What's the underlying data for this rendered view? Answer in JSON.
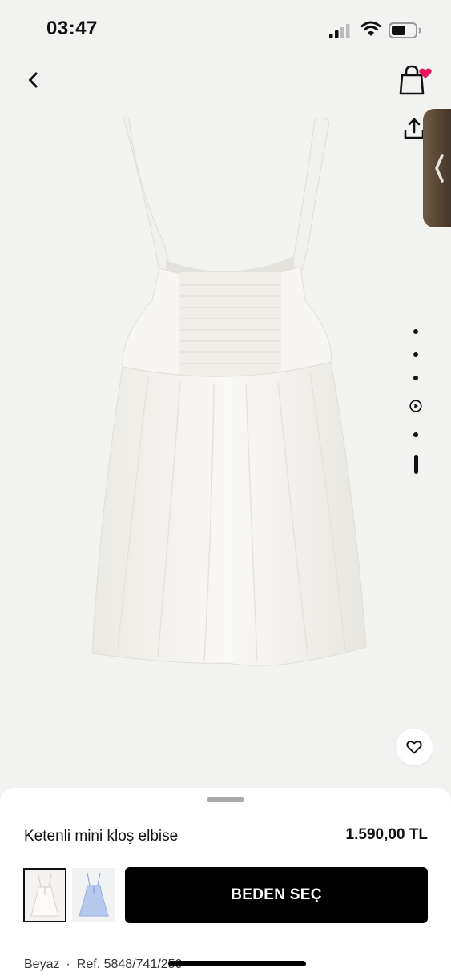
{
  "status_bar": {
    "time": "03:47"
  },
  "header": {
    "back_icon": "chevron-left-icon",
    "bag_icon": "shopping-bag-icon",
    "bag_badge_icon": "heart-icon",
    "bag_badge_color": "#e8175d",
    "share_icon": "share-icon",
    "side_tab_icon": "chevron-left-icon"
  },
  "gallery": {
    "dot_count": 5,
    "video_icon": "play-icon",
    "favorite_icon": "heart-outline-icon"
  },
  "product": {
    "name": "Ketenli mini kloş elbise",
    "price": "1.590,00 TL",
    "color_name": "Beyaz",
    "separator": "·",
    "ref": "Ref. 5848/741/250",
    "variants": [
      "white",
      "light-blue"
    ]
  },
  "actions": {
    "select_size_label": "BEDEN SEÇ"
  },
  "colors": {
    "background": "#f2f2f0",
    "primary_button": "#000000",
    "side_tab": "#5a4837"
  }
}
